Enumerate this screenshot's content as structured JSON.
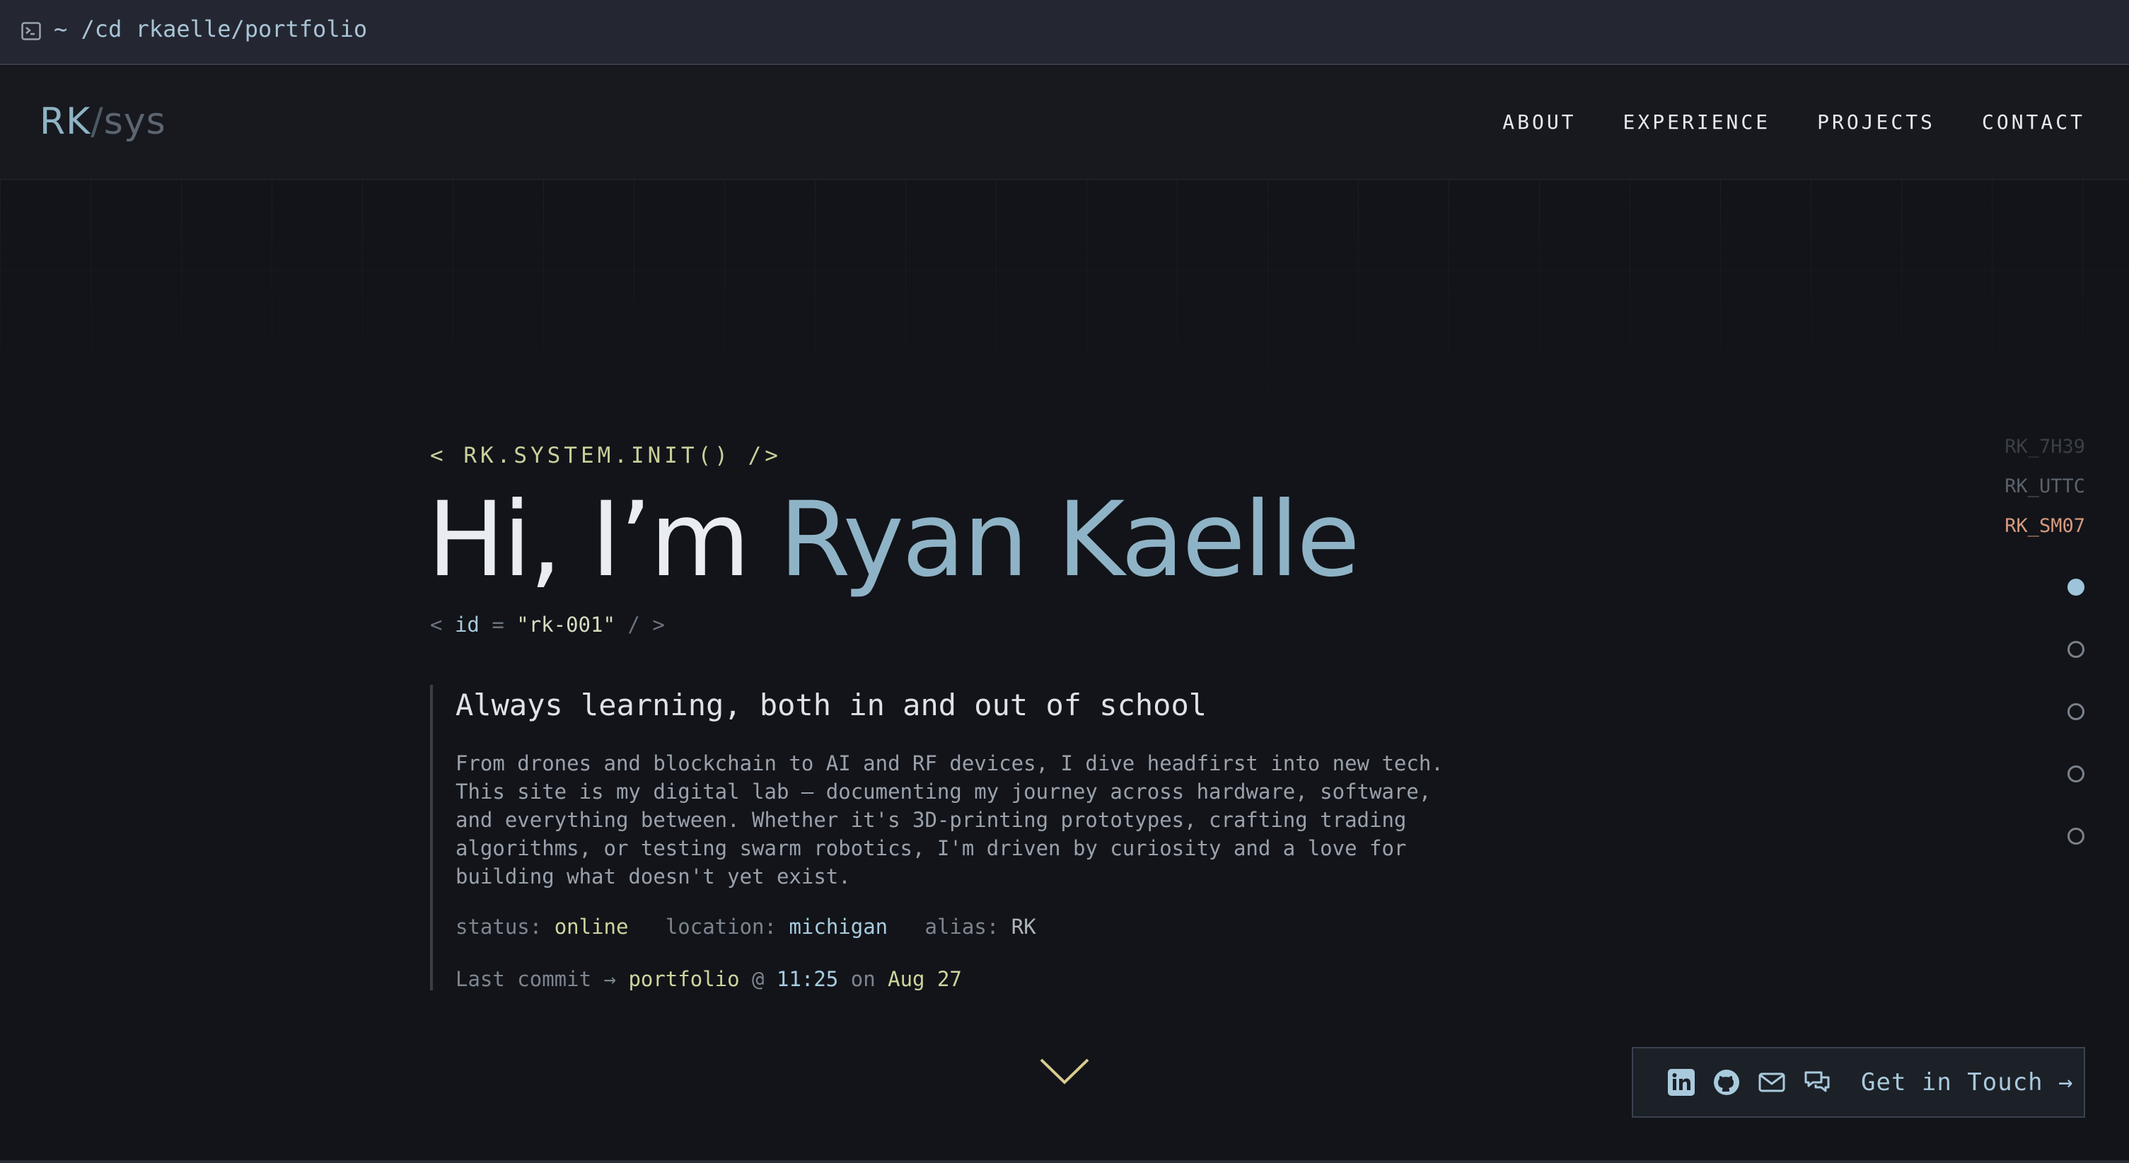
{
  "terminal": {
    "path": "~ /cd rkaelle/portfolio"
  },
  "brand": {
    "rk": "RK",
    "slash": "/",
    "sys": "sys"
  },
  "nav": {
    "items": [
      "ABOUT",
      "EXPERIENCE",
      "PROJECTS",
      "CONTACT"
    ]
  },
  "hero": {
    "init": "< RK.SYSTEM.INIT() />",
    "hi": "Hi, I’m ",
    "name": "Ryan Kaelle",
    "id_open": "<",
    "id_attr": "id",
    "id_eq": " = ",
    "id_val": "\"rk-001\"",
    "id_close": " / >",
    "tagline": "Always learning, both in and out of school",
    "paragraph": "From drones and blockchain to AI and RF devices, I dive headfirst into new tech.\nThis site is my digital lab — documenting my journey across hardware, software,\nand everything between. Whether it's 3D-printing prototypes, crafting trading\nalgorithms, or testing swarm robotics, I'm driven by curiosity and a love for\nbuilding what doesn't yet exist.",
    "meta": {
      "status_label": "status: ",
      "status": "online",
      "location_label": "location: ",
      "location": "michigan",
      "alias_label": "alias: ",
      "alias": "RK"
    },
    "commit": {
      "label": "Last commit → ",
      "repo": "portfolio",
      "at": " @ ",
      "time": "11:25",
      "on": " on ",
      "date": "Aug 27"
    }
  },
  "side_codes": [
    "RK_7H39",
    "RK_UTTC",
    "RK_SM07"
  ],
  "section_dots": {
    "count": 5,
    "active": 0
  },
  "contact": {
    "cta": "Get in Touch →"
  },
  "icons": [
    "terminal-icon",
    "linkedin-icon",
    "github-icon",
    "mail-icon",
    "chat-icon",
    "chevron-down-icon"
  ],
  "colors": {
    "background": "#121419",
    "accent": "#8fb3c6",
    "highlight": "#cfd49e",
    "active_code": "#d79a7e"
  }
}
